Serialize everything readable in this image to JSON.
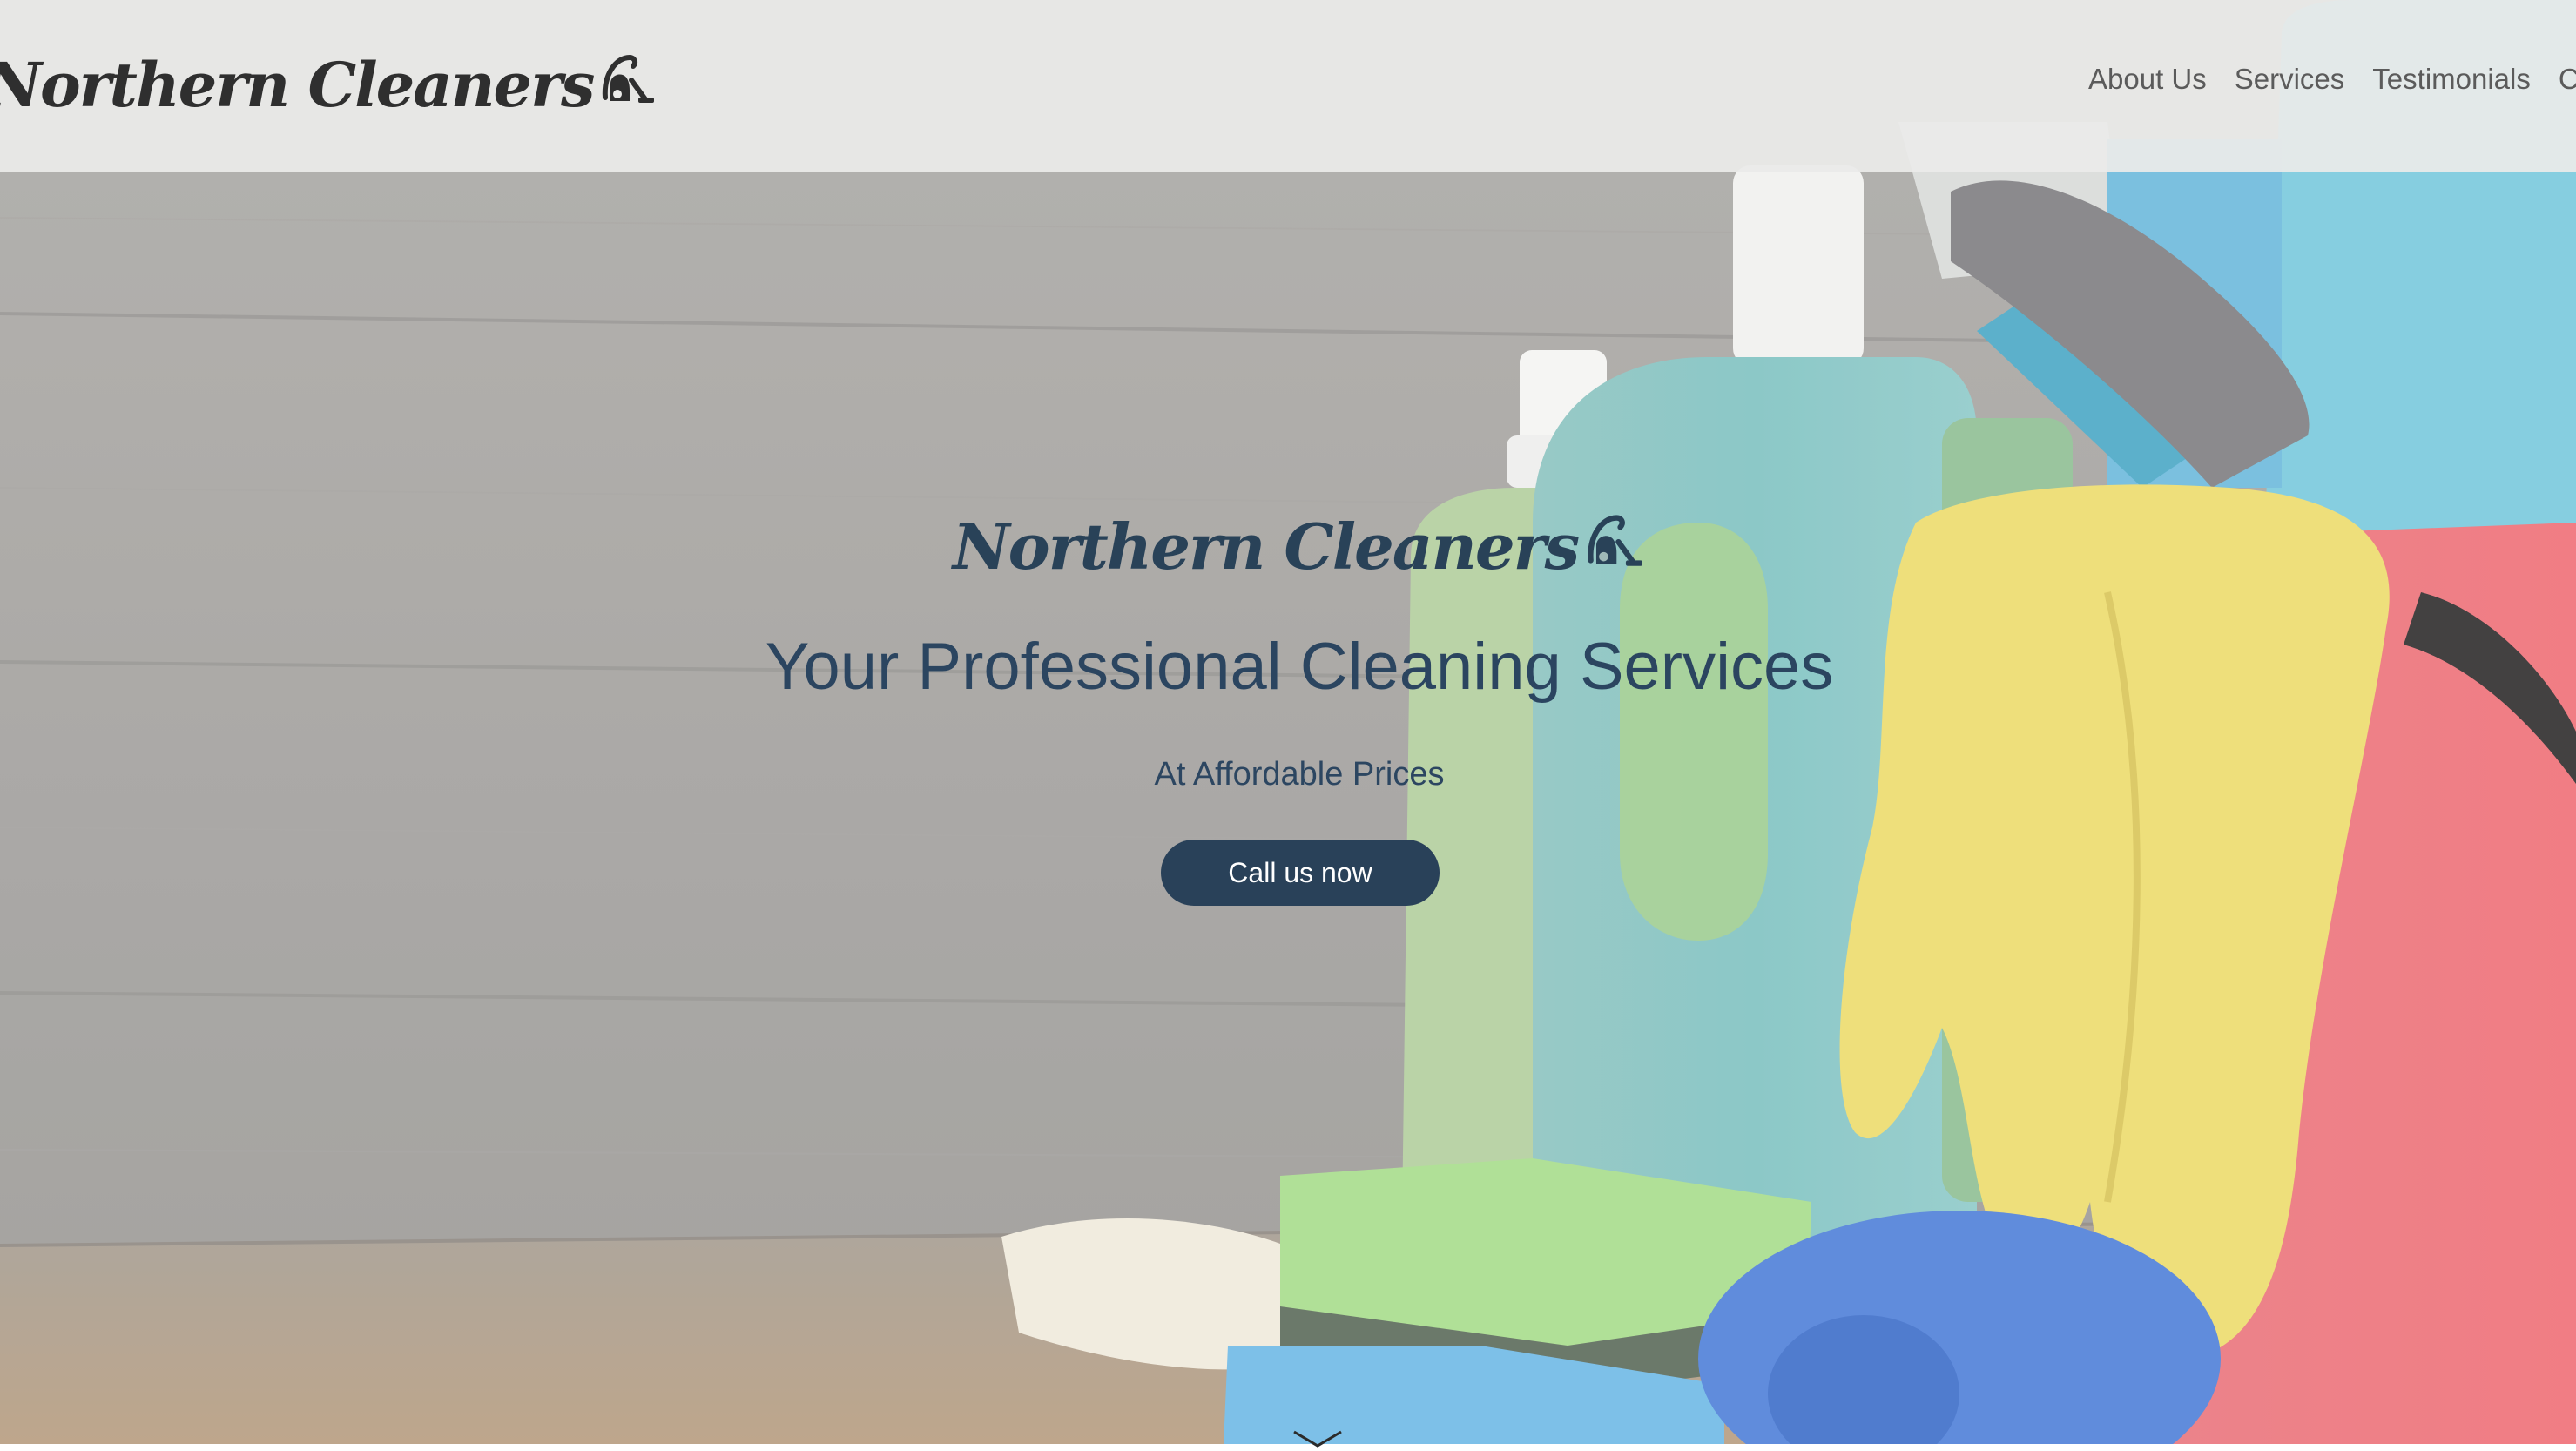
{
  "brand": {
    "name": "Northern Cleaners",
    "icon": "vacuum-icon"
  },
  "nav": {
    "items": [
      {
        "label": "About Us"
      },
      {
        "label": "Services"
      },
      {
        "label": "Testimonials"
      },
      {
        "label": "Contact"
      }
    ]
  },
  "hero": {
    "logo_text": "Northern Cleaners",
    "title": "Your Professional Cleaning Services",
    "subtitle": "At Affordable Prices",
    "cta_label": "Call us now",
    "scroll_icon": "chevron-down-icon",
    "background_image": "cleaning-supplies-photo"
  },
  "colors": {
    "navy": "#294159",
    "nav_text": "#5b5b5b",
    "header_bg": "#ebebe9"
  }
}
